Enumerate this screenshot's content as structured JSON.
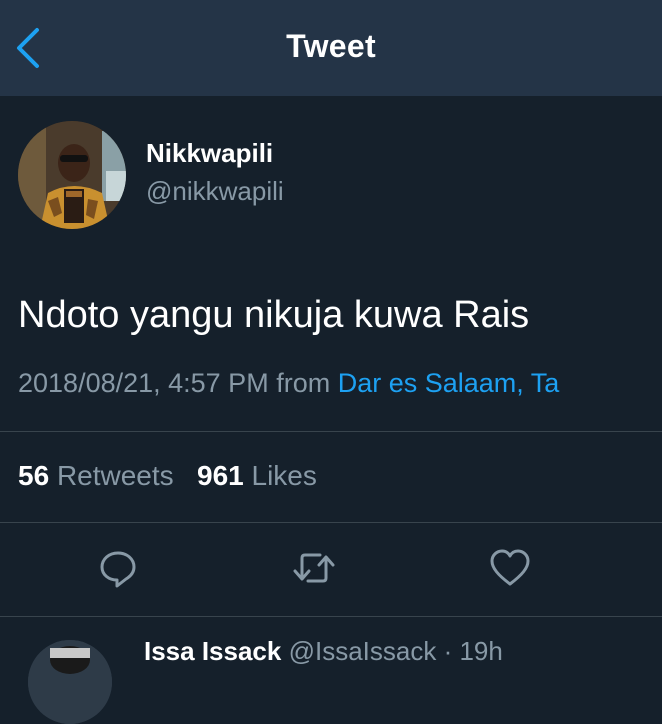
{
  "header": {
    "title": "Tweet",
    "back_icon": "chevron-left-icon",
    "accent": "#1da1f2"
  },
  "tweet": {
    "display_name": "Nikkwapili",
    "handle": "@nikkwapili",
    "text": "Ndoto yangu nikuja kuwa Rais",
    "timestamp": "2018/08/21, 4:57 PM",
    "from_label": "from",
    "location": "Dar es Salaam, Ta",
    "retweets_count": "56",
    "retweets_label": "Retweets",
    "likes_count": "961",
    "likes_label": "Likes"
  },
  "actions": [
    {
      "icon": "reply-icon"
    },
    {
      "icon": "retweet-icon"
    },
    {
      "icon": "heart-icon"
    }
  ],
  "reply": {
    "display_name": "Issa Issack",
    "meta": "@IssaIssack · 19h"
  },
  "colors": {
    "background": "#15202b",
    "header": "#243447",
    "secondary_text": "#8899a6",
    "divider": "#38444d"
  }
}
